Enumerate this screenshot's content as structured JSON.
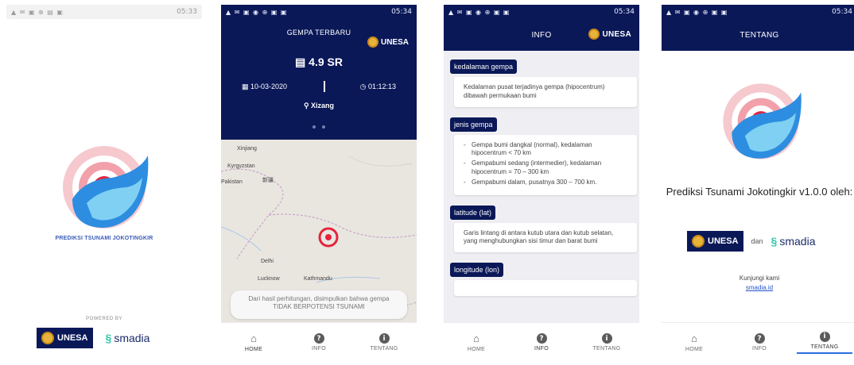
{
  "screen1": {
    "status_time": "05:33",
    "app_title": "PREDIKSI TSUNAMI JOKOTINGKIR",
    "powered_by": "POWERED BY",
    "unesa": "UNESA",
    "smadia": "smadia"
  },
  "screen2": {
    "status_time": "05:34",
    "header_title": "GEMPA TERBARU",
    "unesa": "UNESA",
    "magnitude": "4.9 SR",
    "date": "10-03-2020",
    "time": "01:12:13",
    "location": "Xizang",
    "map_labels": [
      "Xinjiang",
      "Kyrgyzstan",
      "新疆",
      "Pakistan",
      "Delhi",
      "Lucknow",
      "Kathmandu"
    ],
    "notice": "Dari hasil perhitungan, disimpulkan bahwa gempa TIDAK BERPOTENSI TSUNAMI"
  },
  "screen3": {
    "status_time": "05:34",
    "header_title": "INFO",
    "unesa": "UNESA",
    "sections": [
      {
        "title": "kedalaman gempa",
        "body": "Kedalaman pusat terjadinya gempa (hipocentrum) dibawah permukaan bumi"
      },
      {
        "title": "jenis gempa",
        "items": [
          "Gempa bumi dangkal (normal), kedalaman hipocentrum < 70 km",
          "Gempabumi sedang (intermedier), kedalaman hipocentrum = 70 – 300 km",
          "Gempabumi dalam, pusatnya 300 – 700 km."
        ]
      },
      {
        "title": "latitude (lat)",
        "body": "Garis lintang di antara kutub utara dan kutub selatan, yang menghubungkan sisi timur dan barat bumi"
      },
      {
        "title": "longitude (lon)",
        "body": ""
      }
    ]
  },
  "screen4": {
    "status_time": "05:34",
    "header_title": "TENTANG",
    "heading": "Prediksi Tsunami Jokotingkir v1.0.0 oleh:",
    "unesa": "UNESA",
    "dan": "dan",
    "smadia": "smadia",
    "visit": "Kunjungi kami",
    "link": "smadia.id"
  },
  "nav": {
    "home": "HOME",
    "info": "INFO",
    "tentang": "TENTANG"
  },
  "colors": {
    "navy": "#0a1858",
    "accent_red": "#e5243b",
    "accent_blue": "#2d8de0"
  }
}
